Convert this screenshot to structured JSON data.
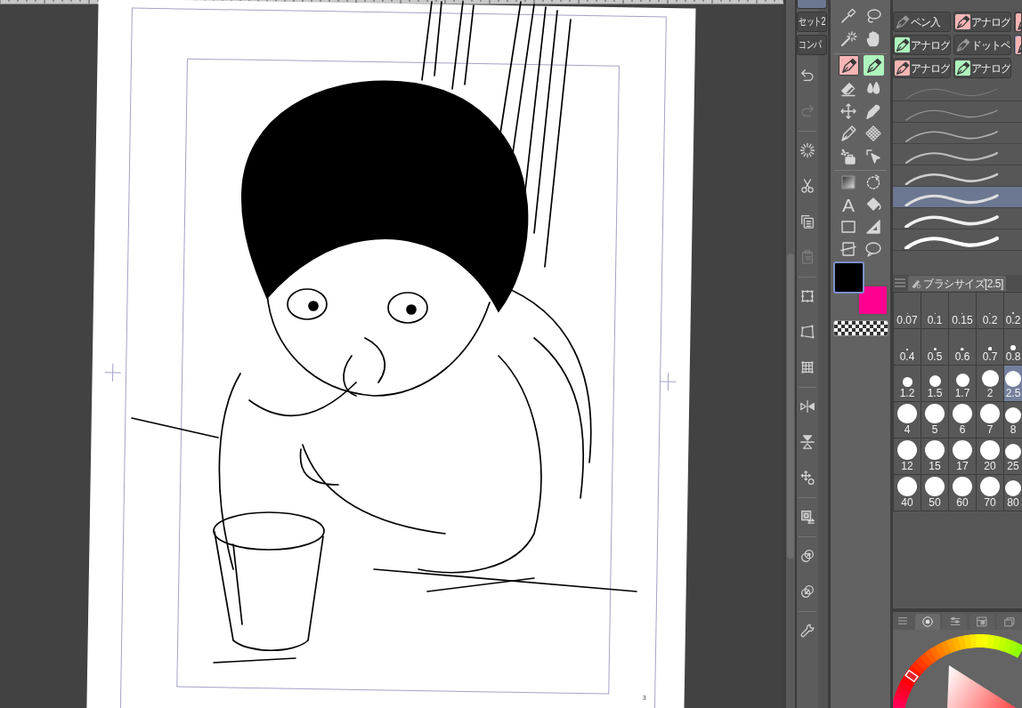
{
  "canvas": {
    "page_number": "3"
  },
  "set_tabs": [
    {
      "selected": true
    },
    {
      "label": "セット2",
      "selected": false
    },
    {
      "label": "コンパ",
      "selected": false
    }
  ],
  "commands": [
    [
      {
        "kind": "undo",
        "disabled": false
      },
      {
        "kind": "redo",
        "disabled": true
      }
    ],
    [
      {
        "kind": "clear",
        "disabled": false
      },
      {
        "kind": "cut",
        "disabled": false
      },
      {
        "kind": "copy",
        "disabled": false
      },
      {
        "kind": "paste",
        "disabled": true
      }
    ],
    [
      {
        "kind": "crop",
        "disabled": false
      },
      {
        "kind": "distort",
        "disabled": false
      },
      {
        "kind": "mesh",
        "disabled": false
      }
    ],
    [
      {
        "kind": "fliph",
        "disabled": false
      },
      {
        "kind": "flipv",
        "disabled": false
      },
      {
        "kind": "rotate",
        "disabled": false
      }
    ],
    [
      {
        "kind": "convert",
        "disabled": false
      }
    ],
    [
      {
        "kind": "expand",
        "disabled": false
      },
      {
        "kind": "shrink",
        "disabled": false
      }
    ],
    [
      {
        "kind": "settings",
        "disabled": false
      }
    ]
  ],
  "tool_groups": [
    [
      {
        "kind": "eyedropper",
        "selected": false
      },
      {
        "kind": "lasso",
        "selected": false
      },
      {
        "kind": "wand",
        "selected": false
      },
      {
        "kind": "hand",
        "selected": false
      }
    ],
    [
      {
        "kind": "pen",
        "color": "#f7b5b5",
        "selected": true
      },
      {
        "kind": "pen",
        "color": "#aef5bd",
        "selected": false
      },
      {
        "kind": "eraser",
        "selected": false
      },
      {
        "kind": "blend",
        "selected": false
      },
      {
        "kind": "move",
        "selected": false
      },
      {
        "kind": "decoration",
        "selected": false
      },
      {
        "kind": "nib",
        "selected": false
      },
      {
        "kind": "pattern",
        "selected": false
      },
      {
        "kind": "airbrush",
        "selected": false
      },
      {
        "kind": "pointer",
        "selected": false
      }
    ],
    [
      {
        "kind": "gradient",
        "selected": false
      },
      {
        "kind": "rotate",
        "selected": false
      },
      {
        "kind": "text",
        "glyph": "A",
        "selected": false
      },
      {
        "kind": "fill",
        "selected": false
      },
      {
        "kind": "rectangle",
        "selected": false
      },
      {
        "kind": "ruler",
        "selected": false
      },
      {
        "kind": "frame",
        "selected": false
      },
      {
        "kind": "balloon",
        "selected": false
      }
    ]
  ],
  "color_swatches": [
    {
      "color": "#000000",
      "selected": true
    },
    {
      "color": "#ff0090",
      "selected": false
    }
  ],
  "brush_buttons": [
    {
      "label": "ペン入",
      "selected": false
    },
    {
      "label": "アナログ",
      "color": "#f7b5b5",
      "selected": false
    },
    {
      "color": "#f7b5b5",
      "selected": false
    },
    {
      "label": "アナログ",
      "color": "#aef5bd",
      "selected": false
    },
    {
      "label": "ドットペ",
      "selected": false
    },
    {
      "color": "#f7b5b5",
      "selected": true
    },
    {
      "label": "アナログ",
      "color": "#f7b5b5",
      "selected": false
    },
    {
      "label": "アナログ",
      "color": "#aef5bd",
      "selected": false
    }
  ],
  "strokes": [
    {
      "selected": false
    },
    {
      "selected": false
    },
    {
      "selected": false
    },
    {
      "selected": false
    },
    {
      "selected": false
    },
    {
      "selected": true
    },
    {
      "selected": false
    },
    {
      "selected": false
    }
  ],
  "brush_size_panel": {
    "tab_label": "ブラシサイズ[2.5]"
  },
  "brush_sizes": [
    {
      "label": "0.07",
      "selected": false
    },
    {
      "label": "0.1",
      "selected": false
    },
    {
      "label": "0.15",
      "selected": false
    },
    {
      "label": "0.2",
      "selected": false
    },
    {
      "label": "0.2",
      "selected": false
    },
    {
      "label": "0.4",
      "selected": false
    },
    {
      "label": "0.5",
      "selected": false
    },
    {
      "label": "0.6",
      "selected": false
    },
    {
      "label": "0.7",
      "selected": false
    },
    {
      "label": "0.8",
      "selected": false
    },
    {
      "label": "1.2",
      "selected": false
    },
    {
      "label": "1.5",
      "selected": false
    },
    {
      "label": "1.7",
      "selected": false
    },
    {
      "label": "2",
      "selected": false
    },
    {
      "label": "2.5",
      "selected": true
    },
    {
      "label": "4",
      "selected": false
    },
    {
      "label": "5",
      "selected": false
    },
    {
      "label": "6",
      "selected": false
    },
    {
      "label": "7",
      "selected": false
    },
    {
      "label": "8",
      "selected": false
    },
    {
      "label": "12",
      "selected": false
    },
    {
      "label": "15",
      "selected": false
    },
    {
      "label": "17",
      "selected": false
    },
    {
      "label": "20",
      "selected": false
    },
    {
      "label": "25",
      "selected": false
    },
    {
      "label": "40",
      "selected": false
    },
    {
      "label": "50",
      "selected": false
    },
    {
      "label": "60",
      "selected": false
    },
    {
      "label": "70",
      "selected": false
    },
    {
      "label": "80",
      "selected": false
    }
  ],
  "color_panel_tabs": [
    {
      "kind": "wheel",
      "selected": true
    },
    {
      "kind": "sliders",
      "selected": false
    },
    {
      "kind": "palette",
      "selected": false
    },
    {
      "kind": "windows",
      "selected": false
    }
  ]
}
